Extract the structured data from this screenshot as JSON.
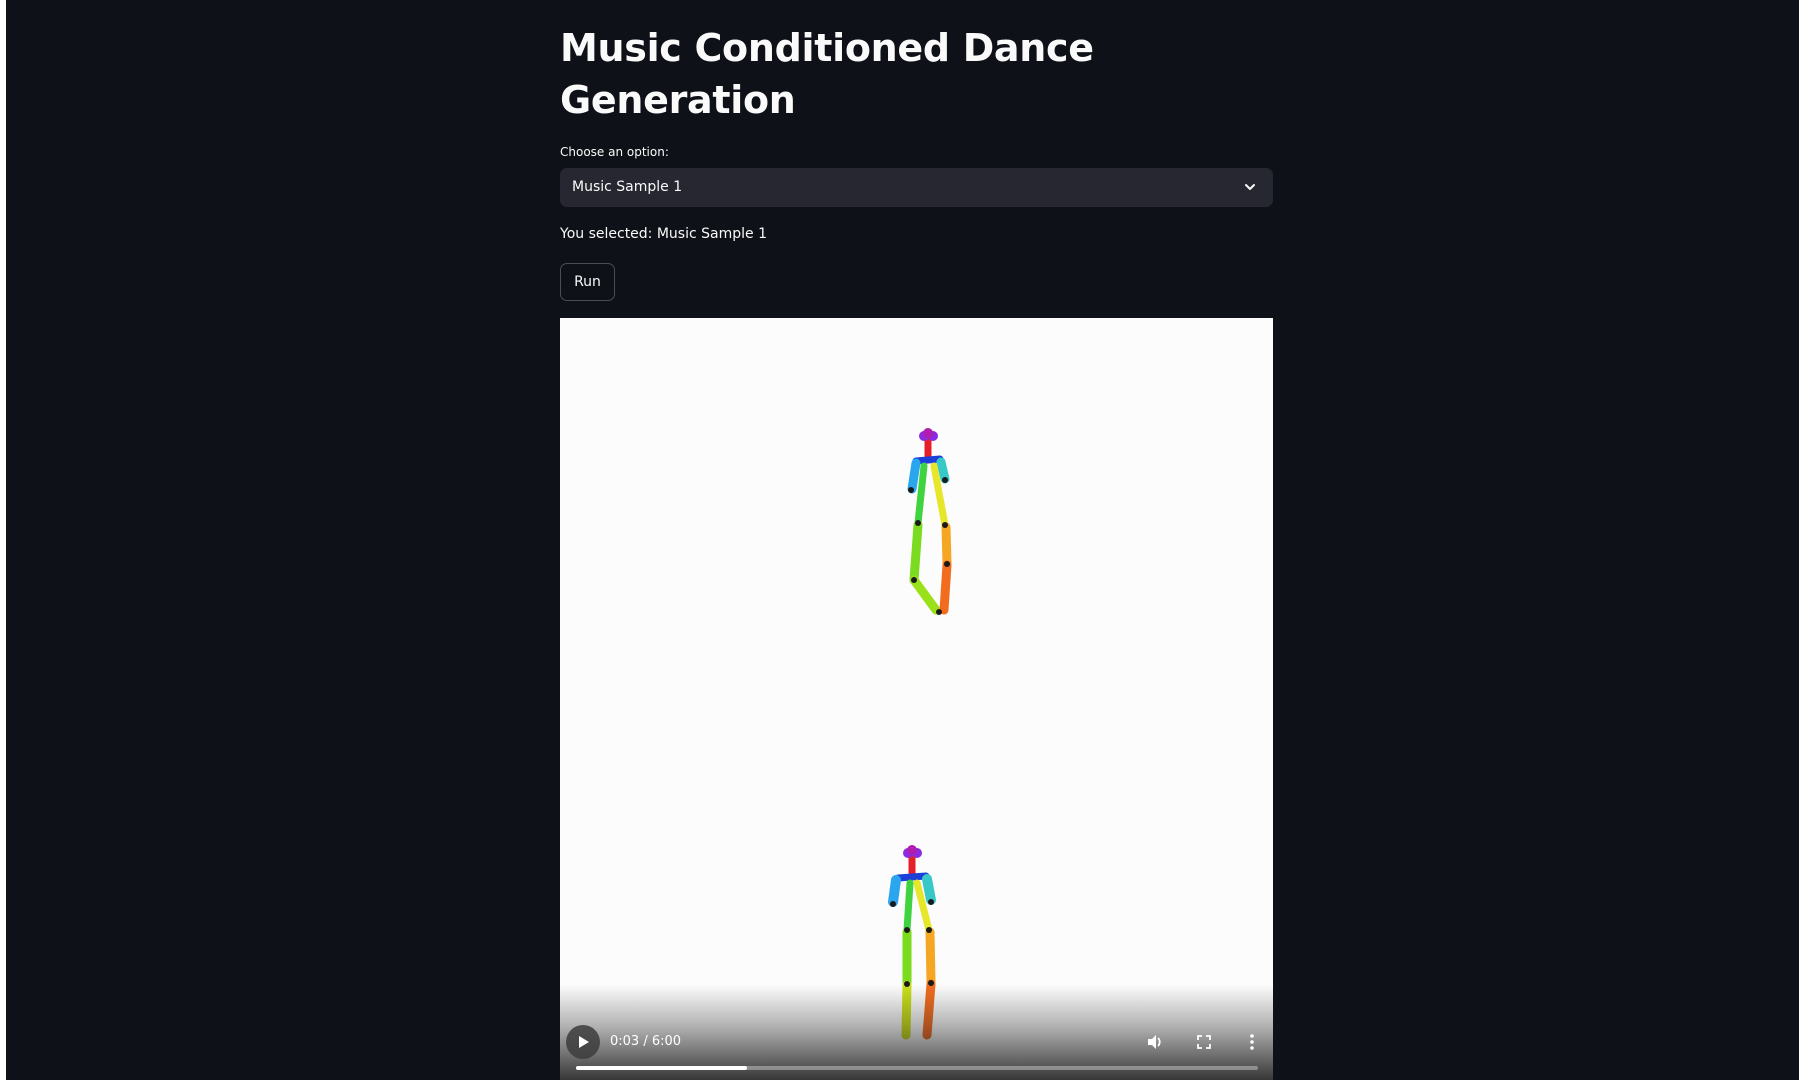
{
  "page": {
    "title": "Music Conditioned Dance Generation"
  },
  "selectbox": {
    "label": "Choose an option:",
    "value": "Music Sample 1"
  },
  "selection_text": "You selected: Music Sample 1",
  "run_button": {
    "label": "Run"
  },
  "video": {
    "time_display": "0:03 / 6:00",
    "progress_fraction": 0.25,
    "icons": [
      "play-icon",
      "volume-icon",
      "fullscreen-icon",
      "more-options-icon"
    ]
  },
  "colors": {
    "app_background": "#0e1117",
    "select_background": "#262730",
    "text": "#fafafa",
    "video_background": "#fbfcfb"
  }
}
